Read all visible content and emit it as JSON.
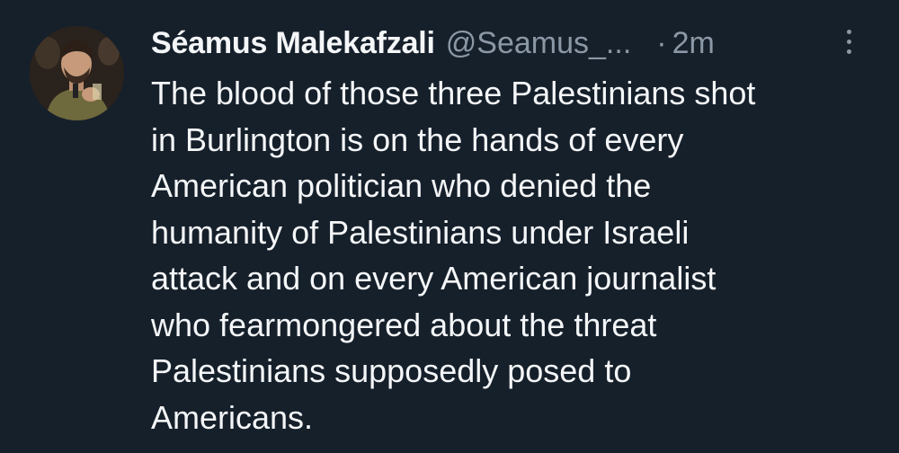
{
  "tweet": {
    "author": {
      "display_name": "Séamus Malekafzali",
      "handle": "@Seamus_...",
      "avatar_icon": "avatar-photo"
    },
    "separator": "·",
    "timestamp": "2m",
    "more_icon": "more-vertical-icon",
    "text_lines": [
      "The blood of those three Palestinians shot",
      "in Burlington is on the hands of every",
      "American politician who denied the",
      "humanity of Palestinians under Israeli",
      "attack and on every American journalist",
      "who fearmongered about the threat",
      "Palestinians supposedly posed to",
      "Americans."
    ]
  },
  "colors": {
    "background": "#16202b",
    "primary_text": "#f4f6f8",
    "secondary_text": "#8b98a5"
  }
}
